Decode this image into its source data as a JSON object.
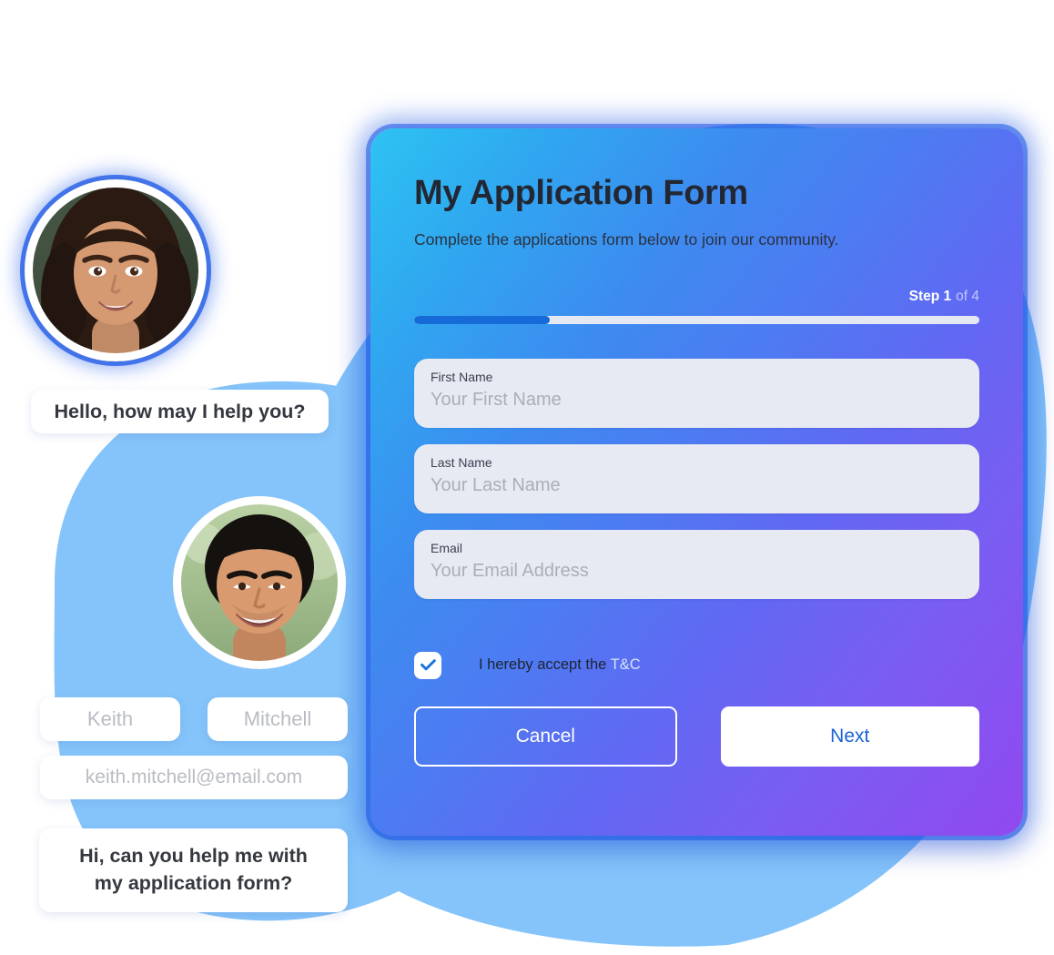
{
  "background": {
    "blob_color": "#85c4fa",
    "page_background": "#ffffff"
  },
  "form_card": {
    "title": "My Application Form",
    "subtitle": "Complete the applications form below to join our community.",
    "gradient_start": "#2ec3f2",
    "gradient_end": "#9148f0",
    "glow_color": "#1a56e6",
    "progress": {
      "step_label": "Step 1",
      "step_rest": "of 4",
      "current_step": 1,
      "total_steps": 4,
      "percent": 24,
      "fill_color": "#166bd8",
      "track_color": "#e4e8f2"
    },
    "fields": [
      {
        "label": "First Name",
        "placeholder": "Your First Name",
        "value": ""
      },
      {
        "label": "Last Name",
        "placeholder": "Your Last Name",
        "value": ""
      },
      {
        "label": "Email",
        "placeholder": "Your Email Address",
        "value": ""
      }
    ],
    "terms": {
      "checked": true,
      "text": "I hereby accept the",
      "link_label": "T&C",
      "link_color": "#d8e4fb",
      "check_color": "#1a72e0"
    },
    "buttons": {
      "cancel_label": "Cancel",
      "next_label": "Next",
      "next_text_color": "#1a63d6"
    }
  },
  "chat": {
    "agent": {
      "avatar_alt": "agent-avatar-woman",
      "message": "Hello, how may I help you?"
    },
    "user": {
      "avatar_alt": "user-avatar-man",
      "message_line_1": "Hi, can you help me with",
      "message_line_2": "my application form?"
    },
    "captured_fields": [
      {
        "name": "first-name",
        "value": "Keith"
      },
      {
        "name": "last-name",
        "value": "Mitchell"
      },
      {
        "name": "email",
        "value": "keith.mitchell@email.com"
      }
    ]
  }
}
